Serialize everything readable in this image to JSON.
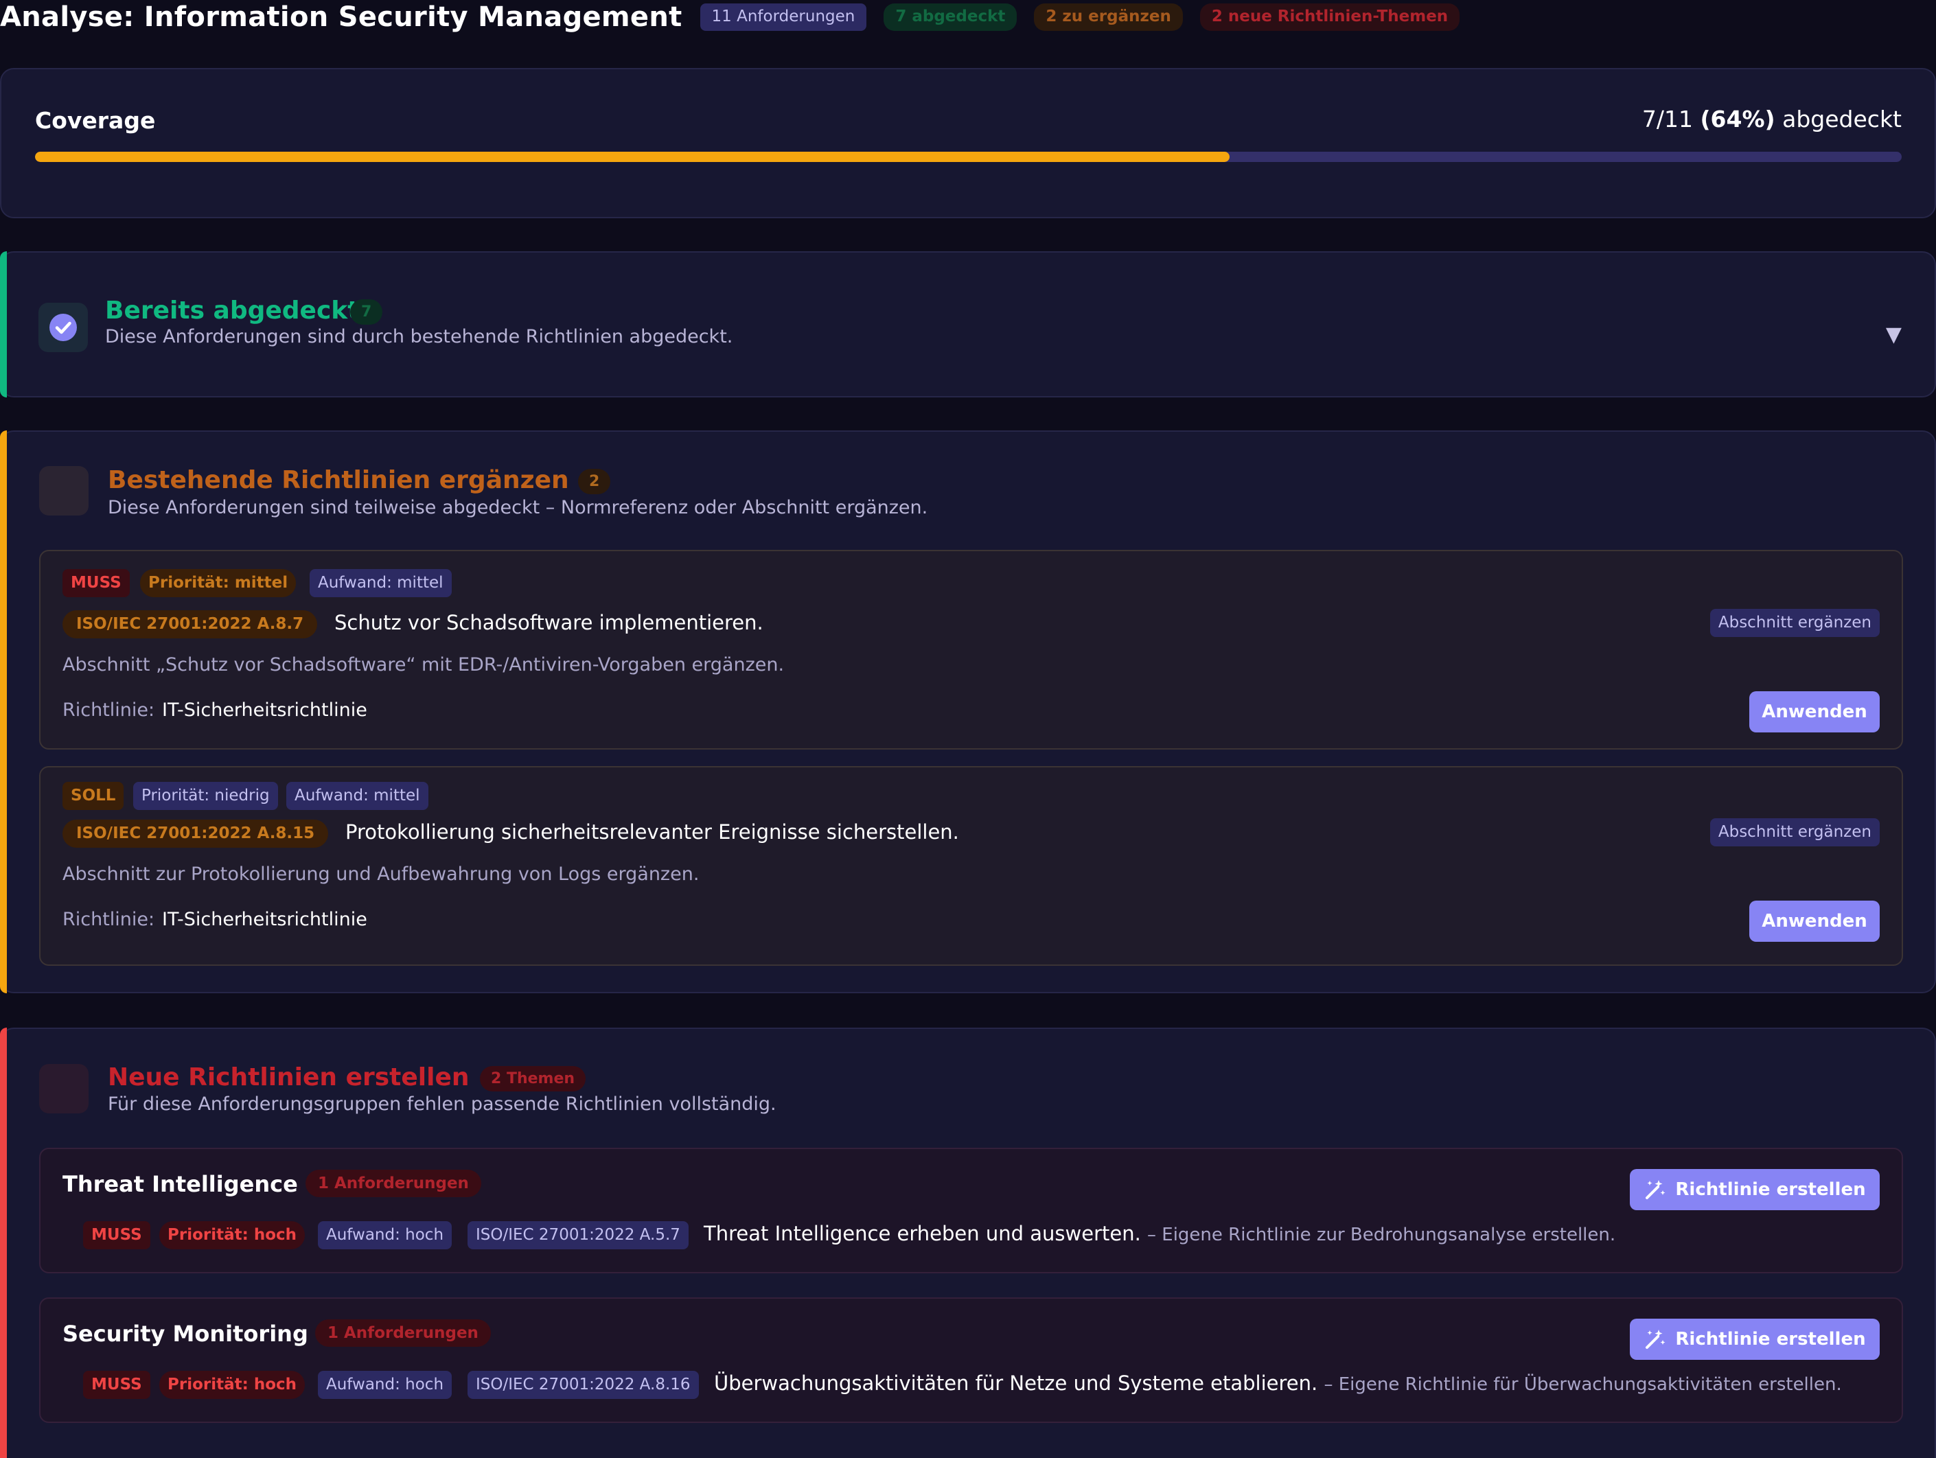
{
  "header": {
    "title": "Analyse: Information Security Management",
    "pills": {
      "requirements": "11 Anforderungen",
      "covered": "7 abgedeckt",
      "to_extend": "2 zu ergänzen",
      "new_topics": "2 neue Richtlinien-Themen"
    }
  },
  "coverage": {
    "title": "Coverage",
    "ratio": "7/11",
    "percent": "(64%)",
    "suffix": "abgedeckt",
    "fraction": 0.64
  },
  "covered_section": {
    "title": "Bereits abgedeckt",
    "count": "7",
    "description": "Diese Anforderungen sind durch bestehende Richtlinien abgedeckt."
  },
  "extend_section": {
    "title": "Bestehende Richtlinien ergänzen",
    "count": "2",
    "description": "Diese Anforderungen sind teilweise abgedeckt – Normreferenz oder Abschnitt ergänzen.",
    "items": [
      {
        "level": "MUSS",
        "priority": "Priorität: mittel",
        "effort": "Aufwand: mittel",
        "norm": "ISO/IEC 27001:2022 A.8.7",
        "text": "Schutz vor Schadsoftware implementieren.",
        "action_tag": "Abschnitt ergänzen",
        "recommendation": "Abschnitt „Schutz vor Schadsoftware“ mit EDR-/Antiviren-Vorgaben ergänzen.",
        "policy_label": "Richtlinie:",
        "policy": "IT-Sicherheitsrichtlinie",
        "button": "Anwenden"
      },
      {
        "level": "SOLL",
        "priority": "Priorität: niedrig",
        "effort": "Aufwand: mittel",
        "norm": "ISO/IEC 27001:2022 A.8.15",
        "text": "Protokollierung sicherheitsrelevanter Ereignisse sicherstellen.",
        "action_tag": "Abschnitt ergänzen",
        "recommendation": "Abschnitt zur Protokollierung und Aufbewahrung von Logs ergänzen.",
        "policy_label": "Richtlinie:",
        "policy": "IT-Sicherheitsrichtlinie",
        "button": "Anwenden"
      }
    ]
  },
  "new_section": {
    "title": "Neue Richtlinien erstellen",
    "count": "2 Themen",
    "description": "Für diese Anforderungsgruppen fehlen passende Richtlinien vollständig.",
    "topics": [
      {
        "title": "Threat Intelligence",
        "count": "1 Anforderungen",
        "button": "Richtlinie erstellen",
        "level": "MUSS",
        "priority": "Priorität: hoch",
        "effort": "Aufwand: hoch",
        "norm": "ISO/IEC 27001:2022 A.5.7",
        "text": "Threat Intelligence erheben und auswerten.",
        "hint": "– Eigene Richtlinie zur Bedrohungsanalyse erstellen."
      },
      {
        "title": "Security Monitoring",
        "count": "1 Anforderungen",
        "button": "Richtlinie erstellen",
        "level": "MUSS",
        "priority": "Priorität: hoch",
        "effort": "Aufwand: hoch",
        "norm": "ISO/IEC 27001:2022 A.8.16",
        "text": "Überwachungsaktivitäten für Netze und Systeme etablieren.",
        "hint": "– Eigene Richtlinie für Überwachungsaktivitäten erstellen."
      }
    ]
  },
  "colors": {
    "accent_green": "#10b981",
    "accent_orange": "#f5a60f",
    "accent_red": "#ef4444",
    "button": "#8784f4"
  },
  "icons": {
    "covered": "check-circle-icon",
    "expand": "chevron-down-icon",
    "create": "magic-wand-icon"
  }
}
